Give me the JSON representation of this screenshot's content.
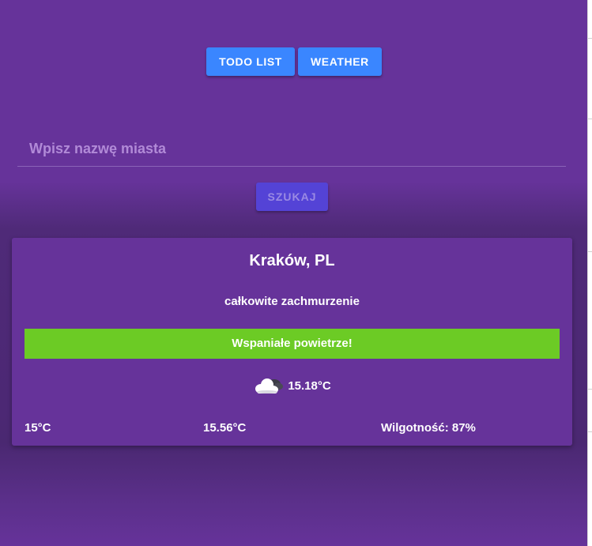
{
  "nav": {
    "todo_label": "TODO LIST",
    "weather_label": "WEATHER"
  },
  "search": {
    "placeholder": "Wpisz nazwę miasta",
    "value": "",
    "button_label": "SZUKAJ"
  },
  "weather": {
    "city": "Kraków, PL",
    "description": "całkowite zachmurzenie",
    "air_quality": "Wspaniałe powietrze!",
    "icon": "cloud-icon",
    "current_temp": "15.18°C",
    "temp_min": "15°C",
    "temp_max": "15.56°C",
    "humidity": "Wilgotność: 87%"
  },
  "colors": {
    "background": "#66339a",
    "nav_button": "#3a86ff",
    "search_button": "#5443d6",
    "air_quality_good": "#6ccb25"
  }
}
